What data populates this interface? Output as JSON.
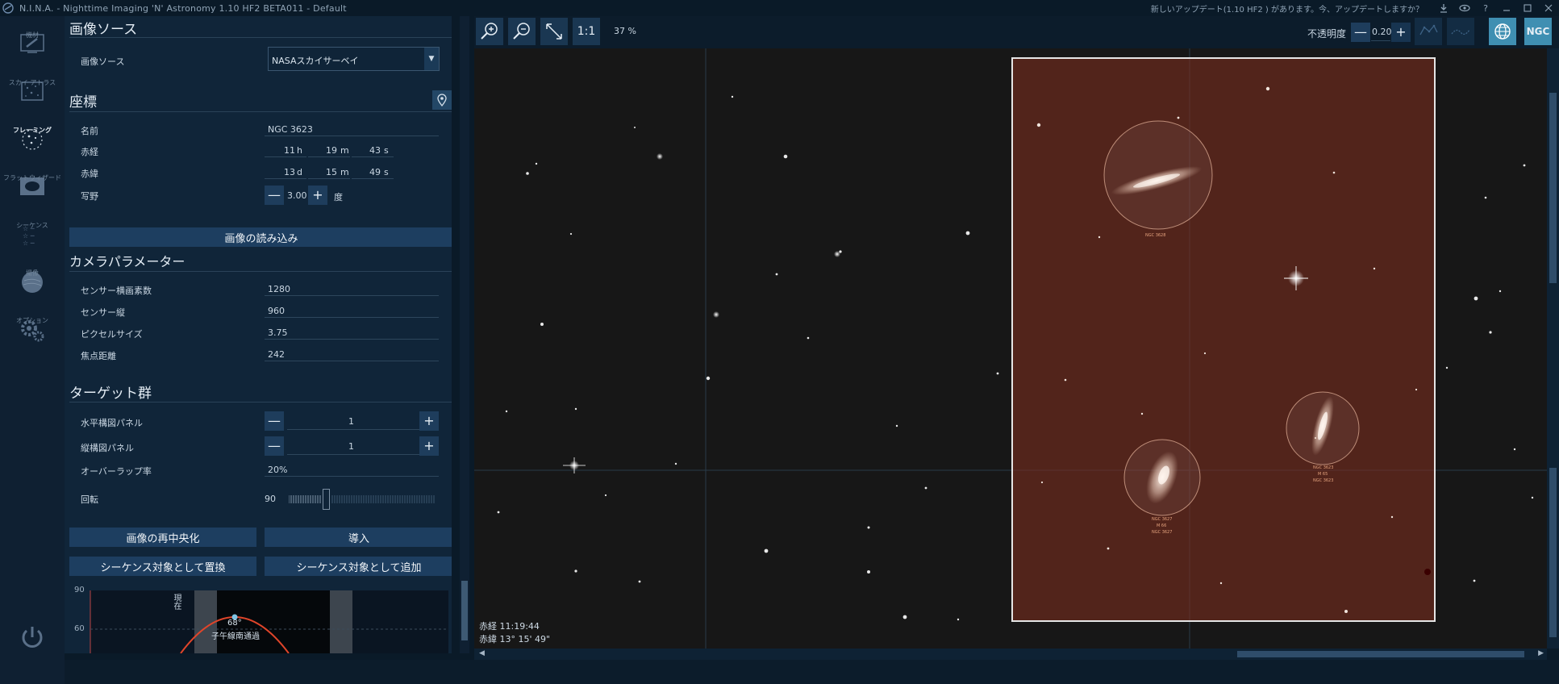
{
  "window": {
    "title": "N.I.N.A. - Nighttime Imaging 'N' Astronomy 1.10 HF2 BETA011  -  Default",
    "update_notice": "新しいアップデート(1.10 HF2 ) があります。今、アップデートしますか？"
  },
  "nav": {
    "items": [
      {
        "label": "機材",
        "icon": "telescope-icon"
      },
      {
        "label": "スカイ アトラス",
        "icon": "sky-atlas-icon"
      },
      {
        "label": "フレーミング",
        "icon": "framing-icon",
        "active": true
      },
      {
        "label": "フラットウィザード",
        "icon": "flat-wizard-icon"
      },
      {
        "label": "シーケンス",
        "icon": "sequence-icon"
      },
      {
        "label": "撮像",
        "icon": "imaging-icon"
      },
      {
        "label": "オプション",
        "icon": "gear-icon"
      }
    ]
  },
  "panel": {
    "image_source": {
      "title": "画像ソース",
      "label": "画像ソース",
      "value": "NASAスカイサーベイ"
    },
    "coordinates": {
      "title": "座標",
      "name_label": "名前",
      "name": "NGC 3623",
      "ra_label": "赤経",
      "ra_h": "11",
      "ra_h_unit": "h",
      "ra_m": "19",
      "ra_m_unit": "m",
      "ra_s": "43",
      "ra_s_unit": "s",
      "dec_label": "赤緯",
      "dec_d": "13",
      "dec_d_unit": "d",
      "dec_m": "15",
      "dec_m_unit": "m",
      "dec_s": "49",
      "dec_s_unit": "s",
      "fov_label": "写野",
      "fov_value": "3.00",
      "fov_unit": "度",
      "load_image_button": "画像の読み込み"
    },
    "camera": {
      "title": "カメラパラメーター",
      "width_label": "センサー横画素数",
      "width_value": "1280",
      "height_label": "センサー縦",
      "height_value": "960",
      "pixel_label": "ピクセルサイズ",
      "pixel_value": "3.75",
      "focal_label": "焦点距離",
      "focal_value": "242"
    },
    "targets": {
      "title": "ターゲット群",
      "h_panels_label": "水平構図パネル",
      "h_panels_value": "1",
      "v_panels_label": "縦構図パネル",
      "v_panels_value": "1",
      "overlap_label": "オーバーラップ率",
      "overlap_value": "20%",
      "rotation_label": "回転",
      "rotation_value": "90"
    },
    "buttons": {
      "recenter": "画像の再中央化",
      "slew": "導入",
      "replace_sequence": "シーケンス対象として置換",
      "add_sequence": "シーケンス対象として追加"
    }
  },
  "altitude_chart": {
    "y_ticks": [
      "90",
      "60"
    ],
    "now_label": "現在",
    "peak_label": "68°",
    "transit_label": "子午線南通過"
  },
  "toolbar": {
    "zoom_in": "zoom-in-icon",
    "zoom_out": "zoom-out-icon",
    "fit": "fit-to-screen-icon",
    "one_to_one": "1:1",
    "zoom_level": "37 %",
    "opacity_label": "不透明度",
    "opacity_value": "0.20",
    "ngc_label": "NGC"
  },
  "viewport": {
    "ra_readout": "赤経  11:19:44",
    "dec_readout": "赤緯  13° 15' 49\"",
    "galaxy_labels": [
      {
        "lines": [
          "NGC 3628"
        ]
      },
      {
        "lines": [
          "NGC 3623",
          "M 65",
          "NGC 3623"
        ]
      },
      {
        "lines": [
          "NGC 3627",
          "M 66",
          "NGC 3627"
        ]
      }
    ]
  },
  "colors": {
    "accent": "#3f8fb2",
    "panel_bg": "#102539",
    "button_bg": "#1d3e60",
    "fov_fill": "#782d1e",
    "altitude_curve": "#e0452a"
  }
}
